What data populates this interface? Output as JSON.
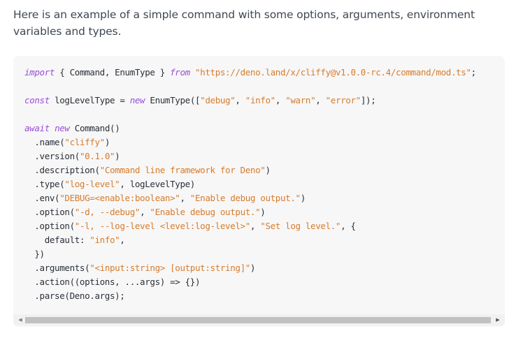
{
  "intro": {
    "text": "Here is an example of a simple command with some options, arguments, environment variables and types."
  },
  "code": {
    "lines": [
      [
        {
          "t": "kw",
          "v": "import"
        },
        {
          "t": "plain",
          "v": " { Command, EnumType } "
        },
        {
          "t": "kw",
          "v": "from"
        },
        {
          "t": "plain",
          "v": " "
        },
        {
          "t": "str",
          "v": "\"https://deno.land/x/cliffy@v1.0.0-rc.4/command/mod.ts\""
        },
        {
          "t": "plain",
          "v": ";"
        }
      ],
      [],
      [
        {
          "t": "kw",
          "v": "const"
        },
        {
          "t": "plain",
          "v": " logLevelType = "
        },
        {
          "t": "kw",
          "v": "new"
        },
        {
          "t": "plain",
          "v": " EnumType(["
        },
        {
          "t": "str",
          "v": "\"debug\""
        },
        {
          "t": "plain",
          "v": ", "
        },
        {
          "t": "str",
          "v": "\"info\""
        },
        {
          "t": "plain",
          "v": ", "
        },
        {
          "t": "str",
          "v": "\"warn\""
        },
        {
          "t": "plain",
          "v": ", "
        },
        {
          "t": "str",
          "v": "\"error\""
        },
        {
          "t": "plain",
          "v": "]);"
        }
      ],
      [],
      [
        {
          "t": "kw",
          "v": "await"
        },
        {
          "t": "plain",
          "v": " "
        },
        {
          "t": "kw",
          "v": "new"
        },
        {
          "t": "plain",
          "v": " Command()"
        }
      ],
      [
        {
          "t": "plain",
          "v": "  .name("
        },
        {
          "t": "str",
          "v": "\"cliffy\""
        },
        {
          "t": "plain",
          "v": ")"
        }
      ],
      [
        {
          "t": "plain",
          "v": "  .version("
        },
        {
          "t": "str",
          "v": "\"0.1.0\""
        },
        {
          "t": "plain",
          "v": ")"
        }
      ],
      [
        {
          "t": "plain",
          "v": "  .description("
        },
        {
          "t": "str",
          "v": "\"Command line framework for Deno\""
        },
        {
          "t": "plain",
          "v": ")"
        }
      ],
      [
        {
          "t": "plain",
          "v": "  .type("
        },
        {
          "t": "str",
          "v": "\"log-level\""
        },
        {
          "t": "plain",
          "v": ", logLevelType)"
        }
      ],
      [
        {
          "t": "plain",
          "v": "  .env("
        },
        {
          "t": "str",
          "v": "\"DEBUG=<enable:boolean>\""
        },
        {
          "t": "plain",
          "v": ", "
        },
        {
          "t": "str",
          "v": "\"Enable debug output.\""
        },
        {
          "t": "plain",
          "v": ")"
        }
      ],
      [
        {
          "t": "plain",
          "v": "  .option("
        },
        {
          "t": "str",
          "v": "\"-d, --debug\""
        },
        {
          "t": "plain",
          "v": ", "
        },
        {
          "t": "str",
          "v": "\"Enable debug output.\""
        },
        {
          "t": "plain",
          "v": ")"
        }
      ],
      [
        {
          "t": "plain",
          "v": "  .option("
        },
        {
          "t": "str",
          "v": "\"-l, --log-level <level:log-level>\""
        },
        {
          "t": "plain",
          "v": ", "
        },
        {
          "t": "str",
          "v": "\"Set log level.\""
        },
        {
          "t": "plain",
          "v": ", {"
        }
      ],
      [
        {
          "t": "plain",
          "v": "    default: "
        },
        {
          "t": "str",
          "v": "\"info\""
        },
        {
          "t": "plain",
          "v": ","
        }
      ],
      [
        {
          "t": "plain",
          "v": "  })"
        }
      ],
      [
        {
          "t": "plain",
          "v": "  .arguments("
        },
        {
          "t": "str",
          "v": "\"<input:string> [output:string]\""
        },
        {
          "t": "plain",
          "v": ")"
        }
      ],
      [
        {
          "t": "plain",
          "v": "  .action((options, ...args) => {})"
        }
      ],
      [
        {
          "t": "plain",
          "v": "  .parse(Deno.args);"
        }
      ]
    ]
  },
  "scrollbar": {
    "left_arrow": "◀",
    "right_arrow": "▶",
    "horizontal_scroll_position": 0
  },
  "colors": {
    "keyword": "#9a4ed6",
    "string": "#d67c2b",
    "code_background": "#f7f7f8",
    "body_text": "#3f4752"
  }
}
